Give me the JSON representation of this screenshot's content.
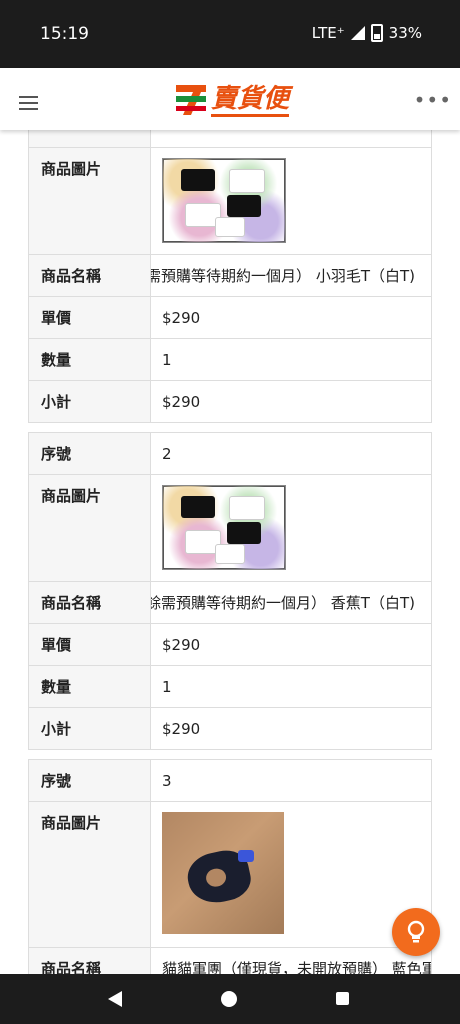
{
  "status": {
    "time": "15:19",
    "network": "LTE⁺",
    "battery": "33%"
  },
  "appbar": {
    "logo_text": "賣貨便",
    "brand": "7-ELEVEN",
    "more": "⋮"
  },
  "labels": {
    "serial": "序號",
    "image": "商品圖片",
    "name": "商品名稱",
    "unit_price": "單價",
    "quantity": "數量",
    "subtotal": "小計"
  },
  "items": [
    {
      "name": "需預購等待期約一個月） 小羽毛T（白T)",
      "unit_price": "$290",
      "quantity": "1",
      "subtotal": "$290"
    },
    {
      "serial": "2",
      "name": "E餘需預購等待期約一個月） 香蕉T（白T)",
      "unit_price": "$290",
      "quantity": "1",
      "subtotal": "$290"
    },
    {
      "serial": "3",
      "name": "貓貓軍團（僅現貨，未開放預購） 藍色軍|"
    }
  ],
  "colors": {
    "brand_orange": "#e8500f",
    "fab": "#f26b1d"
  }
}
